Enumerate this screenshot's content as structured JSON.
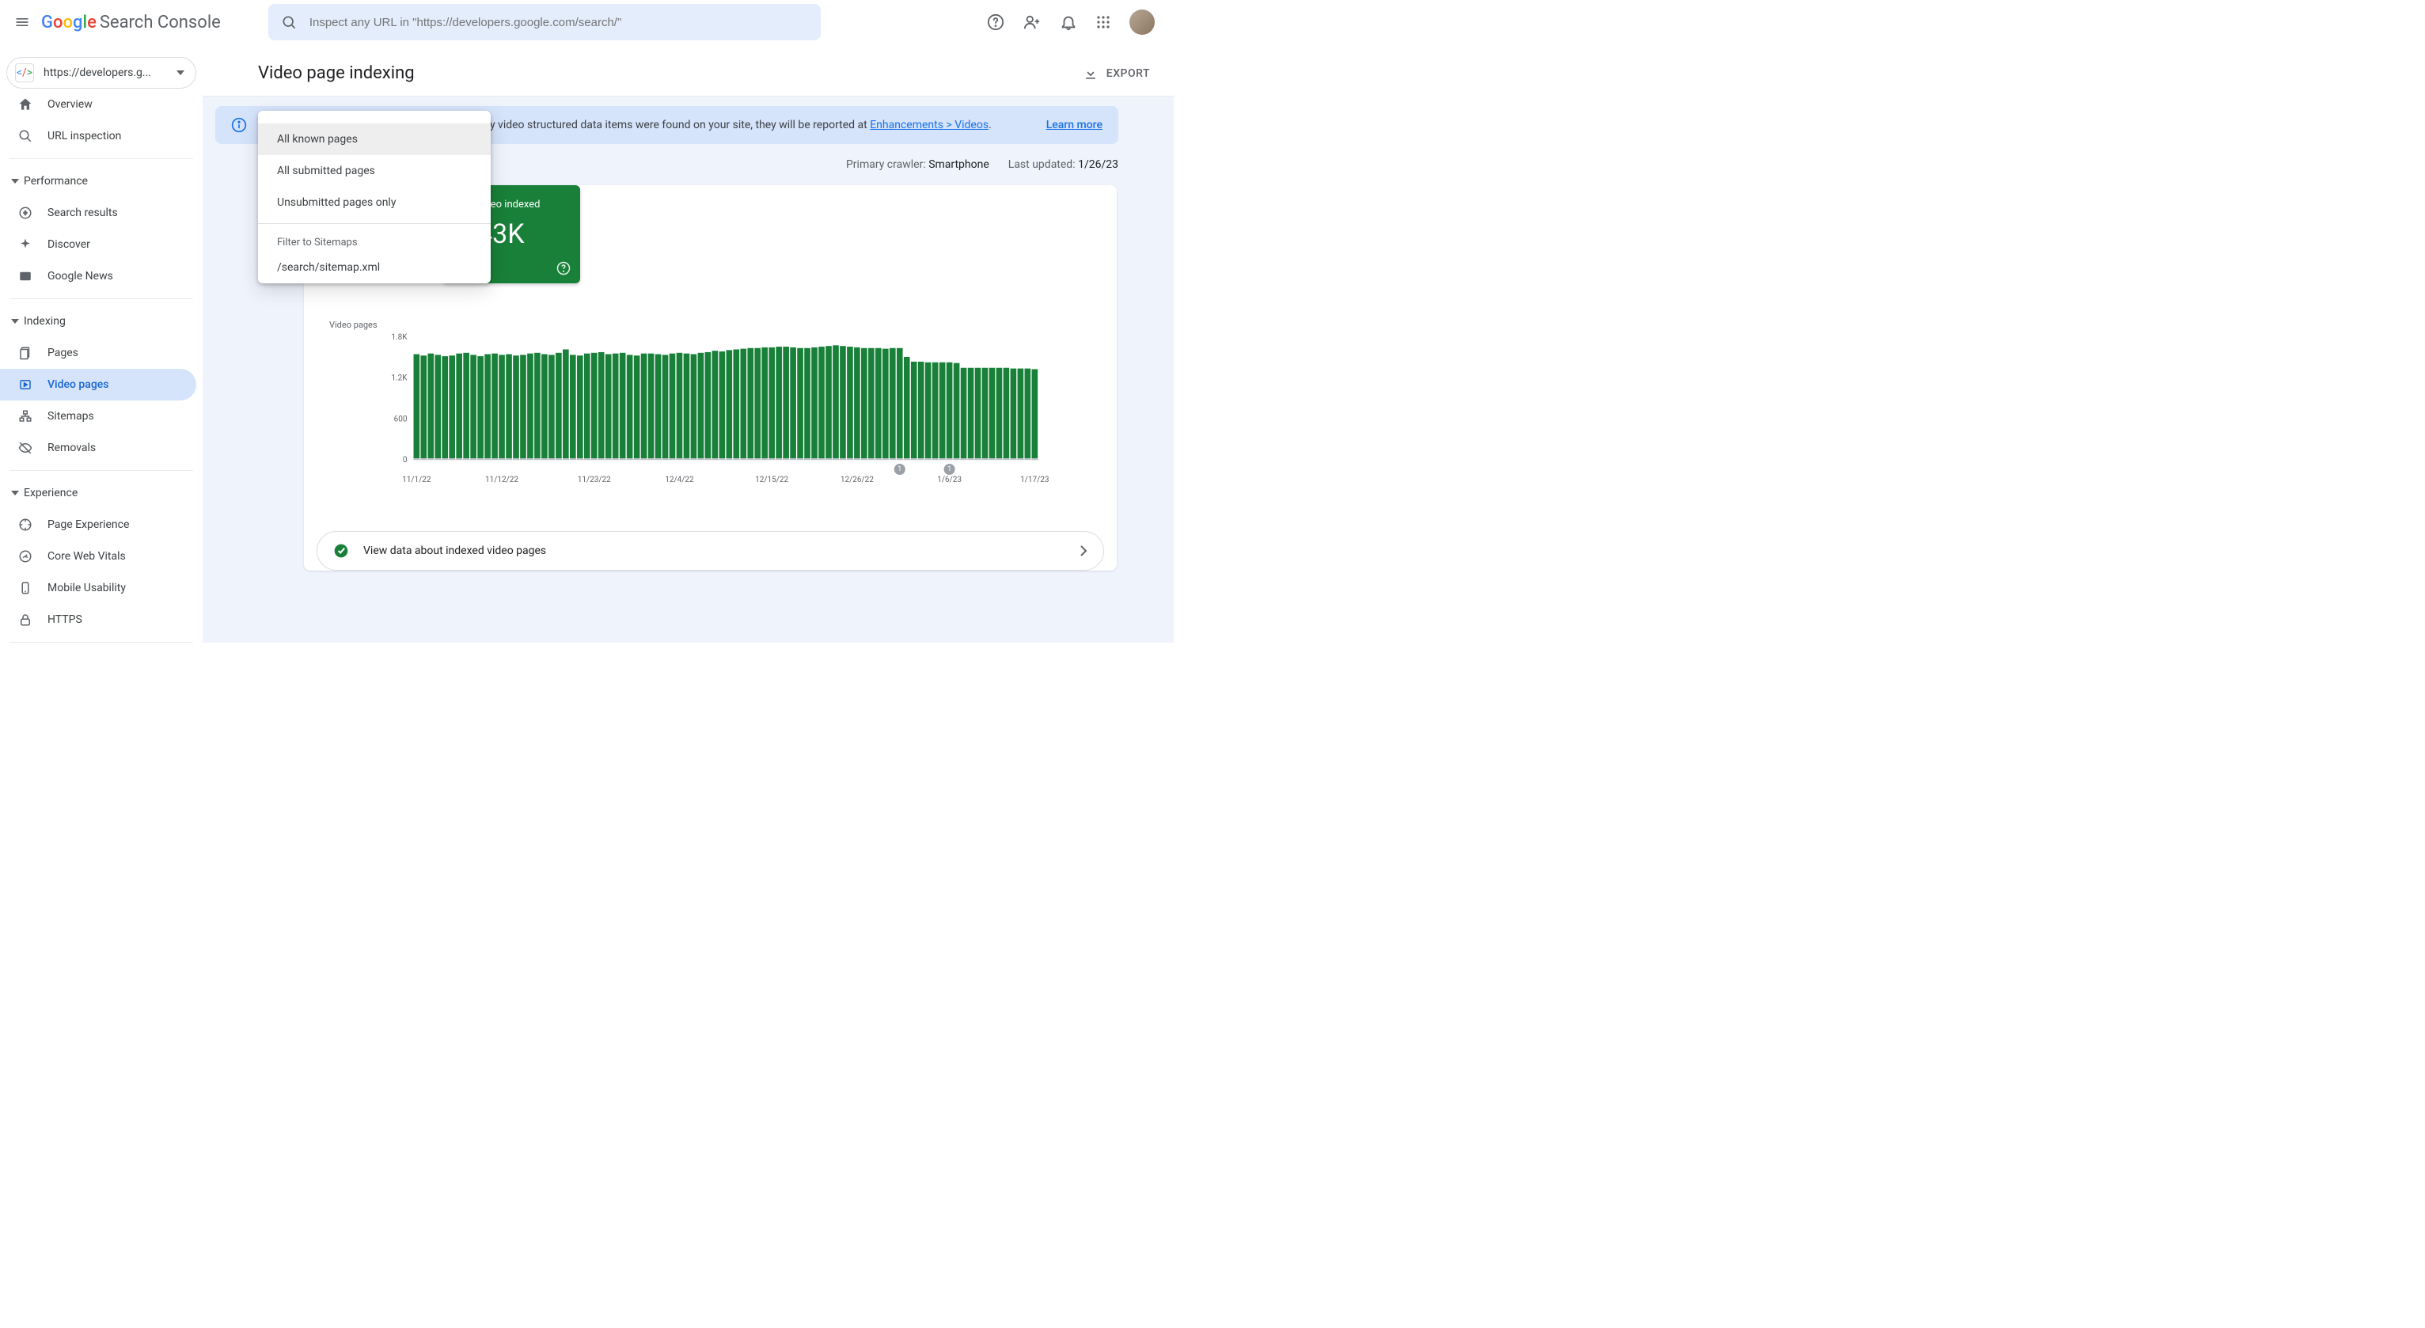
{
  "app": {
    "name": "Search Console"
  },
  "search": {
    "placeholder": "Inspect any URL in \"https://developers.google.com/search/\""
  },
  "property": {
    "label": "https://developers.g..."
  },
  "sidebar": {
    "overview": "Overview",
    "url_inspection": "URL inspection",
    "sections": {
      "performance": {
        "label": "Performance",
        "items": [
          "Search results",
          "Discover",
          "Google News"
        ]
      },
      "indexing": {
        "label": "Indexing",
        "items": [
          "Pages",
          "Video pages",
          "Sitemaps",
          "Removals"
        ]
      },
      "experience": {
        "label": "Experience",
        "items": [
          "Page Experience",
          "Core Web Vitals",
          "Mobile Usability",
          "HTTPS"
        ]
      }
    }
  },
  "page": {
    "title": "Video page indexing",
    "export": "EXPORT"
  },
  "banner": {
    "text_prefix": "This report is about video indexing status. If any video structured data items were found on your site, they will be reported at ",
    "link_text": "Enhancements > Videos",
    "text_suffix": ".",
    "learn_more": "Learn more"
  },
  "meta": {
    "crawler_label": "Primary crawler:",
    "crawler_value": "Smartphone",
    "updated_label": "Last updated:",
    "updated_value": "1/26/23"
  },
  "metric": {
    "label": "Video indexed",
    "value": "1.43K"
  },
  "dropdown": {
    "items": [
      "All known pages",
      "All submitted pages",
      "Unsubmitted pages only"
    ],
    "filter_header": "Filter to Sitemaps",
    "sitemap": "/search/sitemap.xml"
  },
  "chart_data": {
    "type": "bar",
    "title": "Video pages",
    "ylabel": "",
    "ylim": [
      0,
      1800
    ],
    "yticks": [
      0,
      600,
      1200,
      1800
    ],
    "ytick_labels": [
      "0",
      "600",
      "1.2K",
      "1.8K"
    ],
    "x_labels": [
      "11/1/22",
      "11/12/22",
      "11/23/22",
      "12/4/22",
      "12/15/22",
      "12/26/22",
      "1/6/23",
      "1/17/23"
    ],
    "annotations": [
      {
        "x_index": 68,
        "label": "1"
      },
      {
        "x_index": 75,
        "label": "1"
      }
    ],
    "values": [
      1550,
      1530,
      1560,
      1540,
      1520,
      1530,
      1560,
      1570,
      1540,
      1520,
      1550,
      1560,
      1540,
      1550,
      1530,
      1540,
      1560,
      1570,
      1550,
      1540,
      1570,
      1620,
      1540,
      1530,
      1560,
      1570,
      1580,
      1550,
      1560,
      1570,
      1540,
      1530,
      1560,
      1560,
      1550,
      1540,
      1560,
      1570,
      1560,
      1550,
      1570,
      1580,
      1600,
      1590,
      1610,
      1620,
      1630,
      1640,
      1640,
      1650,
      1650,
      1660,
      1660,
      1650,
      1640,
      1640,
      1650,
      1660,
      1670,
      1680,
      1670,
      1660,
      1650,
      1640,
      1640,
      1640,
      1630,
      1640,
      1640,
      1510,
      1440,
      1440,
      1430,
      1430,
      1430,
      1430,
      1420,
      1350,
      1350,
      1350,
      1350,
      1350,
      1350,
      1350,
      1340,
      1340,
      1340,
      1330
    ]
  },
  "view_row": {
    "label": "View data about indexed video pages"
  }
}
